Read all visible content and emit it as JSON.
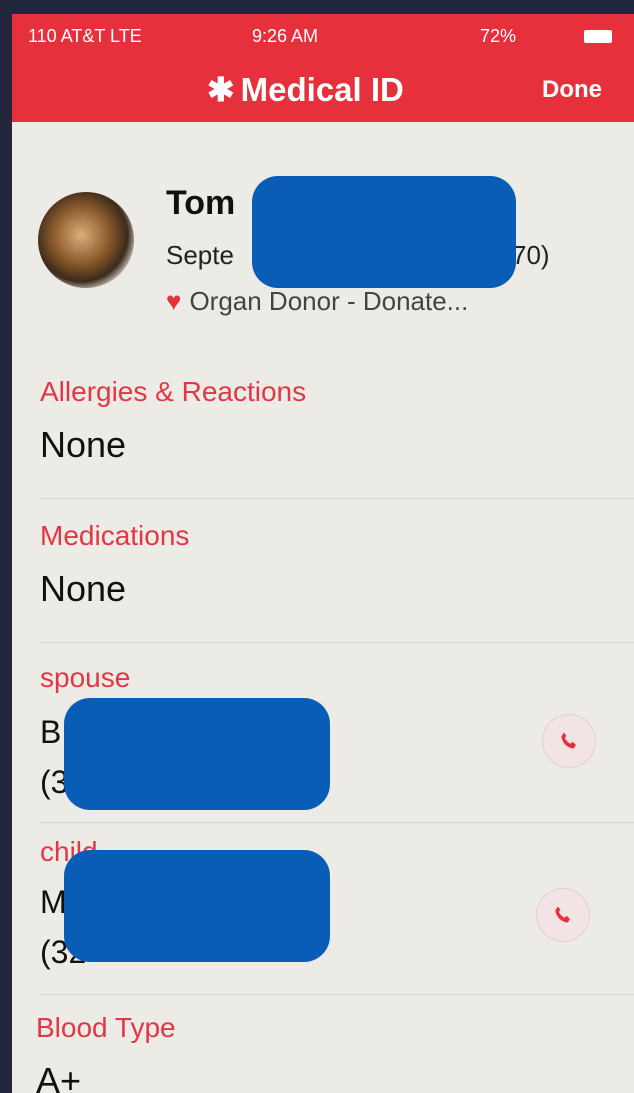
{
  "status_bar": {
    "carrier": "110 AT&T LTE",
    "time": "9:26 AM",
    "battery": "72%"
  },
  "nav": {
    "title": "Medical ID",
    "asterisk": "✱",
    "done_label": "Done"
  },
  "profile": {
    "name_visible": "Tom",
    "birth_visible_start": "Septe",
    "birth_visible_end": "70)",
    "organ_donor": "Organ Donor - Donate..."
  },
  "sections": {
    "allergies": {
      "label": "Allergies & Reactions",
      "value": "None"
    },
    "medications": {
      "label": "Medications",
      "value": "None"
    },
    "spouse": {
      "label": "spouse",
      "name_visible": "B",
      "phone_visible": "(3"
    },
    "child": {
      "label": "child",
      "name_visible": "M",
      "phone_visible": "(32"
    },
    "blood_type": {
      "label": "Blood Type",
      "value": "A+"
    }
  },
  "icons": {
    "heart": "♥",
    "phone": "phone-icon"
  },
  "colors": {
    "accent": "#e6313d",
    "redaction": "#0a5db6"
  }
}
